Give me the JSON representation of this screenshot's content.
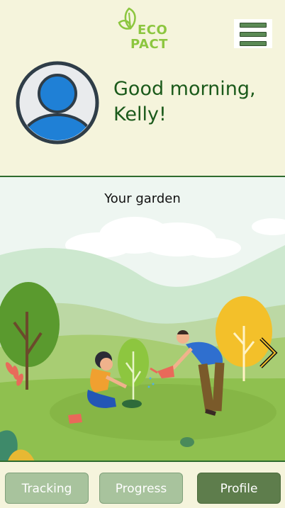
{
  "app": {
    "logo_line1": "ECO",
    "logo_line2": "PACT",
    "menu_icon": "hamburger-menu-icon"
  },
  "header": {
    "greeting_line1": "Good morning,",
    "greeting_line2": "Kelly!",
    "avatar_icon": "user-avatar-icon"
  },
  "garden": {
    "title": "Your garden",
    "next_icon": "chevron-right-icon"
  },
  "nav": {
    "items": [
      {
        "label": "Tracking",
        "active": false
      },
      {
        "label": "Progress",
        "active": false
      },
      {
        "label": "Profile",
        "active": true
      }
    ]
  },
  "colors": {
    "background": "#f5f4dc",
    "greeting": "#1b5a1b",
    "accent_green": "#8cc63f",
    "nav_light": "#a8c39d",
    "nav_dark": "#5e7d4c"
  }
}
